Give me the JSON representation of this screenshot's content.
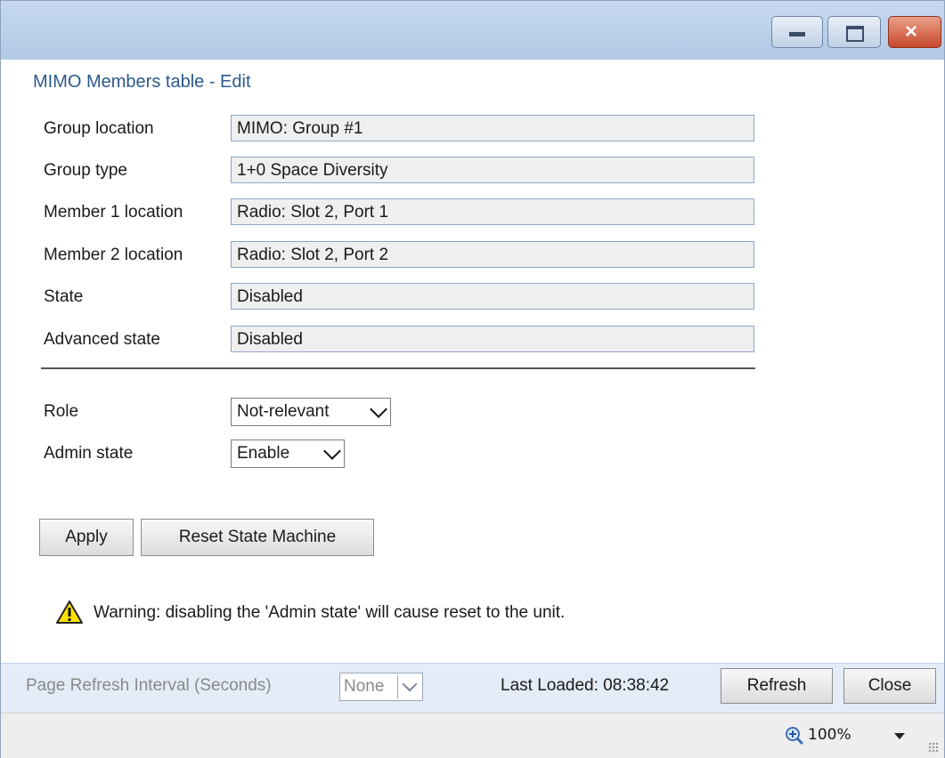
{
  "window": {
    "minimize_icon": "minimize-icon",
    "maximize_icon": "restore-icon",
    "close_icon": "close-icon",
    "close_glyph": "×"
  },
  "heading": "MIMO Members table - Edit",
  "fields": [
    {
      "label": "Group location",
      "value": "MIMO: Group #1"
    },
    {
      "label": "Group type",
      "value": "1+0 Space Diversity"
    },
    {
      "label": "Member 1 location",
      "value": "Radio: Slot 2, Port 1"
    },
    {
      "label": "Member 2 location",
      "value": "Radio: Slot 2, Port 2"
    },
    {
      "label": "State",
      "value": "Disabled"
    },
    {
      "label": "Advanced state",
      "value": "Disabled"
    }
  ],
  "role": {
    "label": "Role",
    "value": "Not-relevant"
  },
  "admin_state": {
    "label": "Admin state",
    "value": "Enable"
  },
  "buttons": {
    "apply": "Apply",
    "reset": "Reset State Machine"
  },
  "warning": {
    "icon": "warning-icon",
    "text": "Warning: disabling the 'Admin state' will cause reset to the unit."
  },
  "footer": {
    "refresh_interval_label": "Page Refresh Interval (Seconds)",
    "refresh_interval_value": "None",
    "last_loaded": "Last Loaded: 08:38:42",
    "refresh_button": "Refresh",
    "close_button": "Close"
  },
  "statusbar": {
    "zoom_icon": "zoom-in-icon",
    "zoom": "100%"
  },
  "colors": {
    "heading": "#2b5a8a",
    "titlebar": "#b2c9e6",
    "footer": "#e4ecf7"
  }
}
